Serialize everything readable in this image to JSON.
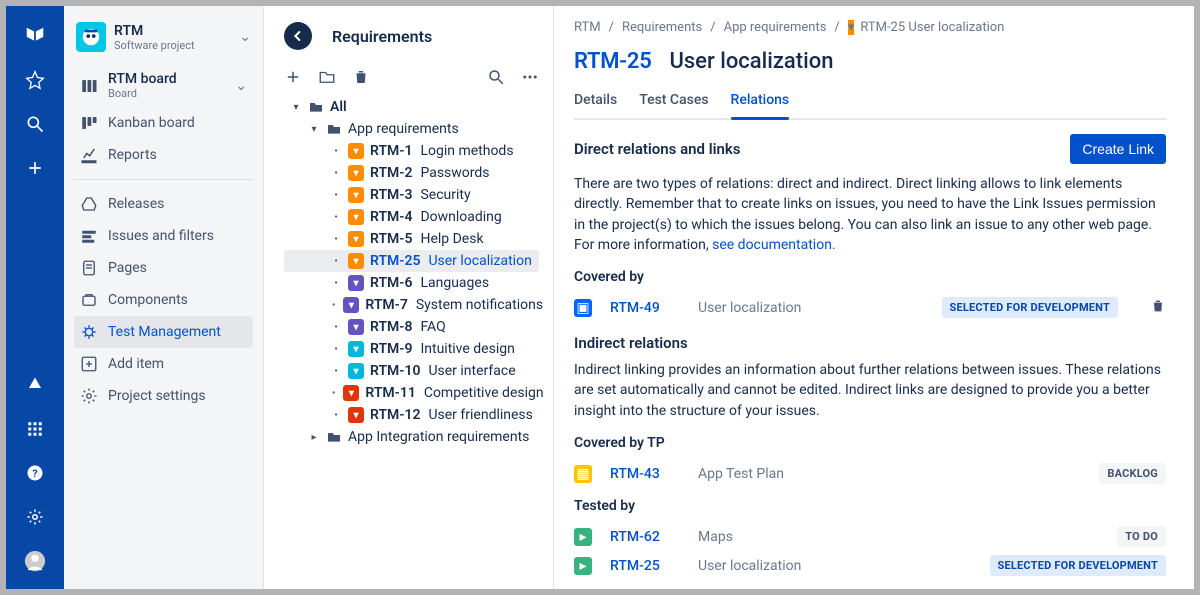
{
  "project": {
    "name": "RTM",
    "type": "Software project"
  },
  "board": {
    "title": "RTM board",
    "subtitle": "Board"
  },
  "sidebar": {
    "kanban": "Kanban board",
    "reports": "Reports",
    "releases": "Releases",
    "issues": "Issues and filters",
    "pages": "Pages",
    "components": "Components",
    "testmgmt": "Test Management",
    "additem": "Add item",
    "settings": "Project settings"
  },
  "tree": {
    "title": "Requirements",
    "root": "All",
    "folder1": "App requirements",
    "folder2": "App Integration requirements",
    "items": [
      {
        "badge": "orange",
        "key": "RTM-1",
        "title": "Login methods"
      },
      {
        "badge": "orange",
        "key": "RTM-2",
        "title": "Passwords"
      },
      {
        "badge": "orange",
        "key": "RTM-3",
        "title": "Security"
      },
      {
        "badge": "orange",
        "key": "RTM-4",
        "title": "Downloading"
      },
      {
        "badge": "orange",
        "key": "RTM-5",
        "title": "Help Desk"
      },
      {
        "badge": "orange",
        "key": "RTM-25",
        "title": "User localization",
        "selected": true
      },
      {
        "badge": "purple",
        "key": "RTM-6",
        "title": "Languages"
      },
      {
        "badge": "purple",
        "key": "RTM-7",
        "title": "System notifications"
      },
      {
        "badge": "purple",
        "key": "RTM-8",
        "title": "FAQ"
      },
      {
        "badge": "teal",
        "key": "RTM-9",
        "title": "Intuitive design"
      },
      {
        "badge": "teal",
        "key": "RTM-10",
        "title": "User interface"
      },
      {
        "badge": "red",
        "key": "RTM-11",
        "title": "Competitive design"
      },
      {
        "badge": "red",
        "key": "RTM-12",
        "title": "User friendliness"
      }
    ]
  },
  "crumbs": [
    "RTM",
    "Requirements",
    "App requirements"
  ],
  "crumb_issue": {
    "key": "RTM-25",
    "title": "User localization"
  },
  "issue": {
    "key": "RTM-25",
    "title": "User localization"
  },
  "tabs": [
    "Details",
    "Test Cases",
    "Relations"
  ],
  "active_tab": 2,
  "direct": {
    "heading": "Direct relations and links",
    "button": "Create Link",
    "text_a": "There are two types of relations: direct and indirect. Direct linking allows to link elements directly. Remember that to create links on issues, you need to have the Link Issues permission in the project(s) to which the issues belong. You can also link an issue to any other web page. For more information, ",
    "text_link": "see documentation."
  },
  "covered_by": {
    "label": "Covered by",
    "row": {
      "icon": "blue",
      "key": "RTM-49",
      "title": "User localization",
      "status": "SELECTED FOR DEVELOPMENT"
    }
  },
  "indirect": {
    "heading": "Indirect relations",
    "text": "Indirect linking provides an information about further relations between issues. These relations are set automatically and cannot be edited. Indirect links are designed to provide you a better insight into the structure of your issues."
  },
  "covered_tp": {
    "label": "Covered by TP",
    "row": {
      "icon": "yellow",
      "key": "RTM-43",
      "title": "App Test Plan",
      "status": "BACKLOG"
    }
  },
  "tested_by": {
    "label": "Tested by",
    "rows": [
      {
        "icon": "green",
        "key": "RTM-62",
        "title": "Maps",
        "status": "TO DO",
        "gray": true
      },
      {
        "icon": "green",
        "key": "RTM-25",
        "title": "User localization",
        "status": "SELECTED FOR DEVELOPMENT"
      }
    ]
  }
}
